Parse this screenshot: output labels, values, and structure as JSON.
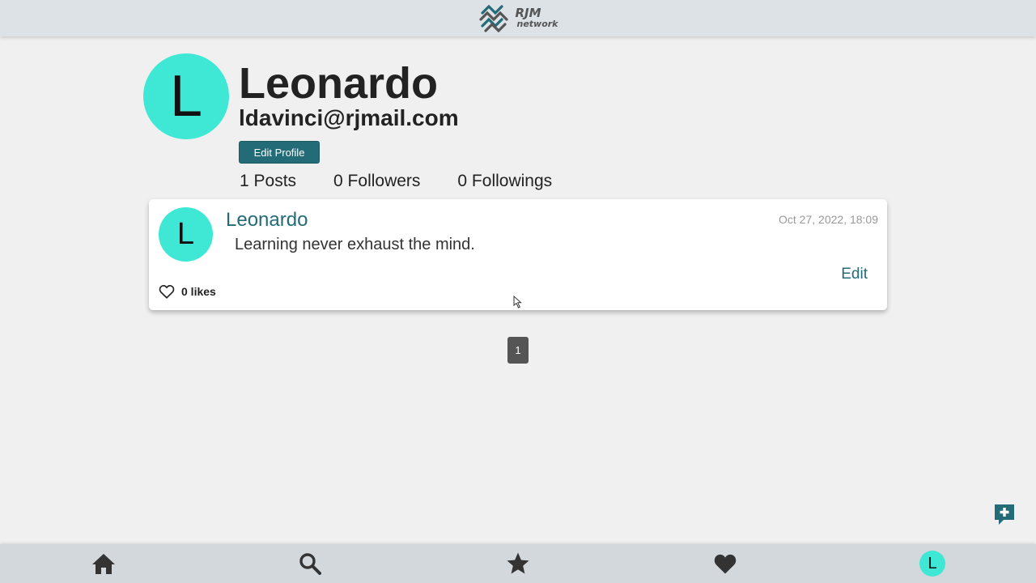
{
  "header": {
    "logo_title": "RJM",
    "logo_subtitle": "network"
  },
  "profile": {
    "avatar_letter": "L",
    "name": "Leonardo",
    "email": "ldavinci@rjmail.com",
    "edit_button": "Edit Profile",
    "stats": {
      "posts": "1 Posts",
      "followers": "0 Followers",
      "followings": "0 Followings"
    }
  },
  "posts": [
    {
      "avatar_letter": "L",
      "author": "Leonardo",
      "timestamp": "Oct 27, 2022, 18:09",
      "content": "Learning never exhaust the mind.",
      "edit_label": "Edit",
      "likes": "0 likes"
    }
  ],
  "pagination": {
    "current": "1"
  },
  "bottom_nav": {
    "items": [
      "home-icon",
      "search-icon",
      "star-icon",
      "heart-icon",
      "profile-avatar"
    ],
    "avatar_letter": "L"
  },
  "colors": {
    "accent": "#246b78",
    "avatar_bg": "#3ee8d4",
    "header_bg": "#dde2e6",
    "nav_bg": "#d3d8dc"
  }
}
